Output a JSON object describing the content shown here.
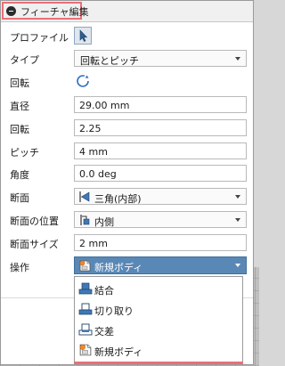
{
  "dialog": {
    "title": "フィーチャ編集"
  },
  "rows": {
    "profile": {
      "label": "プロファイル",
      "icon": "select-cursor-icon"
    },
    "type": {
      "label": "タイプ",
      "value": "回転とピッチ"
    },
    "rotation_dir": {
      "label": "回転",
      "icon": "rotate-icon"
    },
    "diameter": {
      "label": "直径",
      "value": "29.00 mm"
    },
    "revolutions": {
      "label": "回転",
      "value": "2.25"
    },
    "pitch": {
      "label": "ピッチ",
      "value": "4 mm"
    },
    "angle": {
      "label": "角度",
      "value": "0.0 deg"
    },
    "section": {
      "label": "断面",
      "value": "三角(内部)",
      "icon": "triangle-section-icon"
    },
    "section_position": {
      "label": "断面の位置",
      "value": "内側",
      "icon": "section-inside-icon"
    },
    "section_size": {
      "label": "断面サイズ",
      "value": "2 mm"
    },
    "operation": {
      "label": "操作",
      "value": "新規ボディ",
      "icon": "new-body-icon"
    }
  },
  "operation_menu": [
    {
      "label": "結合",
      "icon": "join-icon"
    },
    {
      "label": "切り取り",
      "icon": "cut-icon"
    },
    {
      "label": "交差",
      "icon": "intersect-icon"
    },
    {
      "label": "新規ボディ",
      "icon": "new-body-icon"
    }
  ],
  "colors": {
    "accent": "#5a88b6",
    "highlight": "#e8707a",
    "icon_blue": "#2f5f8f"
  }
}
